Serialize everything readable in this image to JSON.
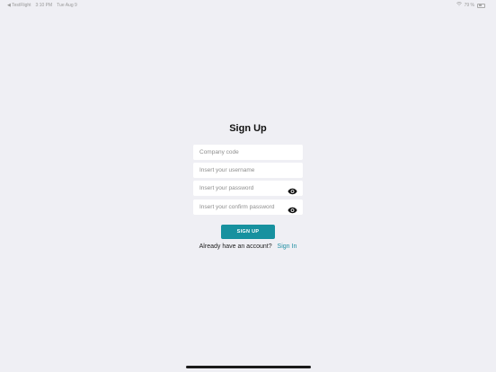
{
  "status_bar": {
    "back_label": "◀ TestFlight",
    "time": "3:10 PM",
    "date": "Tue Aug 9",
    "battery": "79 %"
  },
  "form": {
    "title": "Sign Up",
    "company_code_placeholder": "Company code",
    "username_placeholder": "Insert your username",
    "password_placeholder": "Insert your password",
    "confirm_password_placeholder": "Insert your confirm password",
    "submit_label": "SIGN UP",
    "account_question": "Already have an account?",
    "signin_label": "Sign In"
  },
  "colors": {
    "background": "#efeff4",
    "accent": "#17919f",
    "link": "#1f8fa3"
  },
  "icons": {
    "password_toggle": "eye-icon",
    "confirm_password_toggle": "eye-icon"
  }
}
